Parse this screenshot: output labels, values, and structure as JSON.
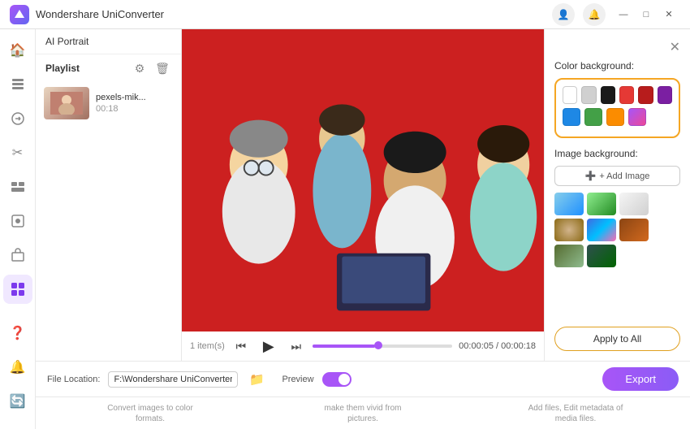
{
  "titlebar": {
    "logo_alt": "Wondershare UniConverter",
    "title": "Wondershare UniConverter",
    "min_label": "—",
    "max_label": "□",
    "close_label": "✕"
  },
  "ai_portrait": {
    "header_label": "AI Portrait",
    "close_label": "✕"
  },
  "playlist": {
    "label": "Playlist",
    "item_count": "1 item(s)",
    "items": [
      {
        "name": "pexels-mik...",
        "duration": "00:18"
      }
    ]
  },
  "video_controls": {
    "prev_label": "⏮",
    "play_label": "▶",
    "next_label": "⏭",
    "time_current": "00:00:05",
    "time_total": "00:00:18",
    "time_separator": " / "
  },
  "right_panel": {
    "color_background_label": "Color background:",
    "image_background_label": "Image background:",
    "add_image_label": "+ Add Image",
    "apply_to_all_label": "Apply to All"
  },
  "bottom_bar": {
    "file_location_label": "File Location:",
    "file_path": "F:\\Wondershare UniConverter",
    "preview_label": "Preview",
    "export_label": "Export"
  },
  "footer": {
    "item1": "Convert images to color formats.",
    "item2": "make them vivid from pictures.",
    "item3": "Add files, Edit metadata of media files."
  },
  "sidebar": {
    "items": [
      {
        "icon": "🏠",
        "name": "home"
      },
      {
        "icon": "⬇",
        "name": "download"
      },
      {
        "icon": "🎬",
        "name": "convert"
      },
      {
        "icon": "✂",
        "name": "edit"
      },
      {
        "icon": "⊞",
        "name": "merge"
      },
      {
        "icon": "📷",
        "name": "compress"
      },
      {
        "icon": "📺",
        "name": "toolbox"
      },
      {
        "icon": "⚡",
        "name": "ai-tools",
        "active": true
      }
    ]
  }
}
